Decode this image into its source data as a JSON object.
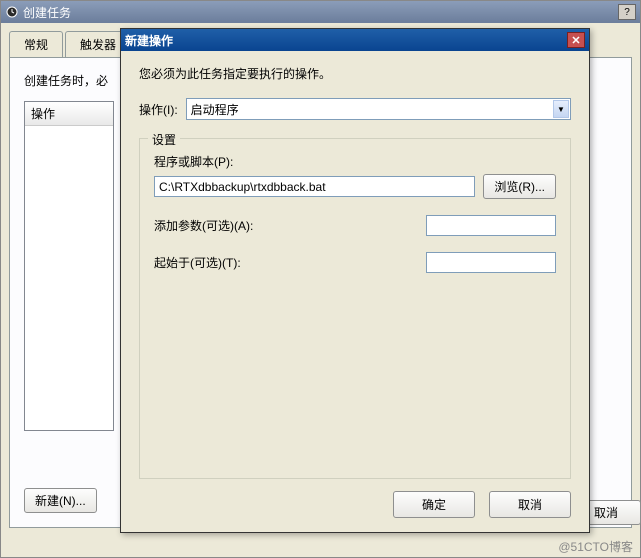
{
  "parent": {
    "title": "创建任务",
    "tabs": {
      "general": "常规",
      "triggers": "触发器"
    },
    "hint_truncated": "创建任务时，必",
    "list_header": "操作",
    "new_button": "新建(N)...",
    "cancel_button_partial": "取消"
  },
  "modal": {
    "title": "新建操作",
    "hint": "您必须为此任务指定要执行的操作。",
    "action_label": "操作(I):",
    "action_value": "启动程序",
    "settings_legend": "设置",
    "script_label": "程序或脚本(P):",
    "script_value": "C:\\RTXdbbackup\\rtxdbback.bat",
    "browse_button": "浏览(R)...",
    "args_label": "添加参数(可选)(A):",
    "args_value": "",
    "startin_label": "起始于(可选)(T):",
    "startin_value": "",
    "ok_button": "确定",
    "cancel_button": "取消"
  },
  "watermark": "@51CTO博客"
}
